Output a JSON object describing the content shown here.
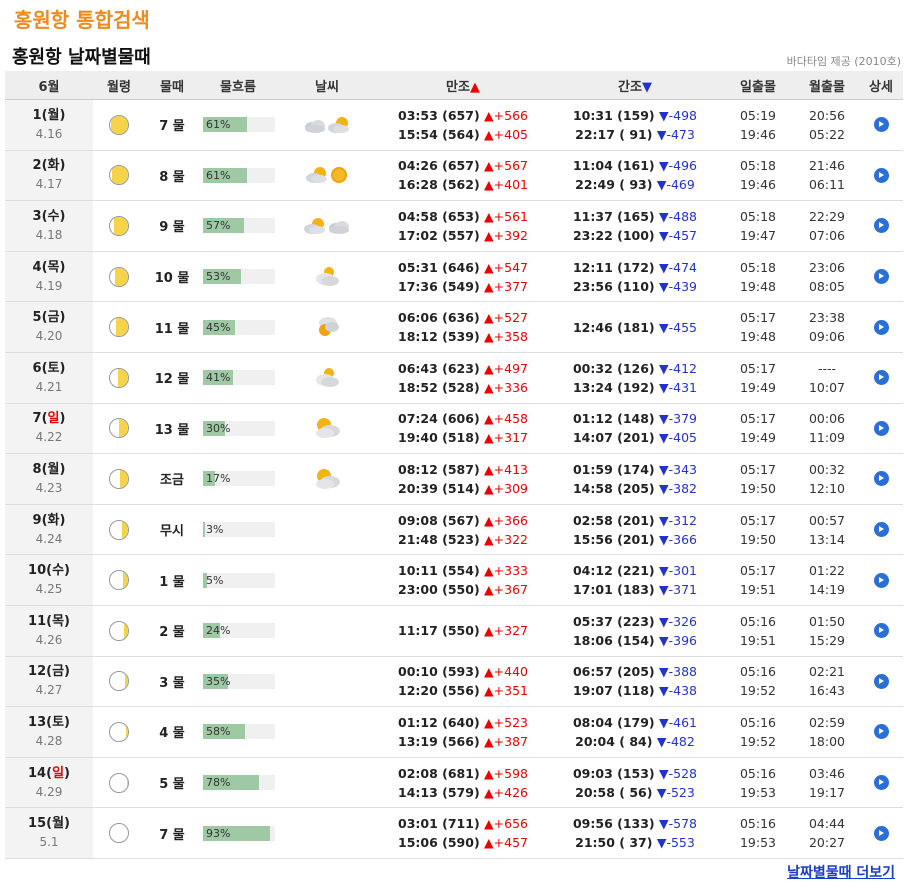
{
  "page_title": "홍원항 통합검색",
  "section_title": "홍원항 날짜별물때",
  "provider": "바다타임 제공 (2010호)",
  "headers": {
    "month": "6월",
    "moon": "월령",
    "tide": "물때",
    "flow": "물흐름",
    "weather": "날씨",
    "high": "만조",
    "high_arrow": "▲",
    "low": "간조",
    "low_arrow": "▼",
    "sun": "일출몰",
    "moonrise": "월출몰",
    "detail": "상세"
  },
  "more_link": "날짜별물때 더보기",
  "rows": [
    {
      "day": "1(월)",
      "greg": "4.16",
      "phase": 0.93,
      "tide": "7 물",
      "flow": 61,
      "flow_label": "61%",
      "weather": [
        "cloud",
        "partly"
      ],
      "high": [
        {
          "t": "03:53 (657)",
          "d": "▲+566"
        },
        {
          "t": "15:54 (564)",
          "d": "▲+405"
        }
      ],
      "low": [
        {
          "t": "10:31 (159)",
          "d": "▼-498"
        },
        {
          "t": "22:17 ( 91)",
          "d": "▼-473"
        }
      ],
      "sun": [
        "05:19",
        "19:46"
      ],
      "moon": [
        "20:56",
        "05:22"
      ]
    },
    {
      "day": "2(화)",
      "greg": "4.17",
      "phase": 0.88,
      "tide": "8 물",
      "flow": 61,
      "flow_label": "61%",
      "weather": [
        "partly",
        "sun"
      ],
      "high": [
        {
          "t": "04:26 (657)",
          "d": "▲+567"
        },
        {
          "t": "16:28 (562)",
          "d": "▲+401"
        }
      ],
      "low": [
        {
          "t": "11:04 (161)",
          "d": "▼-496"
        },
        {
          "t": "22:49 ( 93)",
          "d": "▼-469"
        }
      ],
      "sun": [
        "05:18",
        "19:46"
      ],
      "moon": [
        "21:46",
        "06:11"
      ]
    },
    {
      "day": "3(수)",
      "greg": "4.18",
      "phase": 0.8,
      "tide": "9 물",
      "flow": 57,
      "flow_label": "57%",
      "weather": [
        "partly",
        "cloud"
      ],
      "high": [
        {
          "t": "04:58 (653)",
          "d": "▲+561"
        },
        {
          "t": "17:02 (557)",
          "d": "▲+392"
        }
      ],
      "low": [
        {
          "t": "11:37 (165)",
          "d": "▼-488"
        },
        {
          "t": "23:22 (100)",
          "d": "▼-457"
        }
      ],
      "sun": [
        "05:18",
        "19:47"
      ],
      "moon": [
        "22:29",
        "07:06"
      ]
    },
    {
      "day": "4(목)",
      "greg": "4.19",
      "phase": 0.72,
      "tide": "10 물",
      "flow": 53,
      "flow_label": "53%",
      "weather": [
        "cloudsun"
      ],
      "high": [
        {
          "t": "05:31 (646)",
          "d": "▲+547"
        },
        {
          "t": "17:36 (549)",
          "d": "▲+377"
        }
      ],
      "low": [
        {
          "t": "12:11 (172)",
          "d": "▼-474"
        },
        {
          "t": "23:56 (110)",
          "d": "▼-439"
        }
      ],
      "sun": [
        "05:18",
        "19:48"
      ],
      "moon": [
        "23:06",
        "08:05"
      ]
    },
    {
      "day": "5(금)",
      "greg": "4.20",
      "phase": 0.64,
      "tide": "11 물",
      "flow": 45,
      "flow_label": "45%",
      "weather": [
        "sunbelow"
      ],
      "high": [
        {
          "t": "06:06 (636)",
          "d": "▲+527"
        },
        {
          "t": "18:12 (539)",
          "d": "▲+358"
        }
      ],
      "low": [
        {
          "t": "12:46 (181)",
          "d": "▼-455"
        }
      ],
      "sun": [
        "05:17",
        "19:48"
      ],
      "moon": [
        "23:38",
        "09:06"
      ]
    },
    {
      "day": "6(토)",
      "greg": "4.21",
      "phase": 0.56,
      "tide": "12 물",
      "flow": 41,
      "flow_label": "41%",
      "weather": [
        "cloudsun"
      ],
      "high": [
        {
          "t": "06:43 (623)",
          "d": "▲+497"
        },
        {
          "t": "18:52 (528)",
          "d": "▲+336"
        }
      ],
      "low": [
        {
          "t": "00:32 (126)",
          "d": "▼-412"
        },
        {
          "t": "13:24 (192)",
          "d": "▼-431"
        }
      ],
      "sun": [
        "05:17",
        "19:49"
      ],
      "moon": [
        "----",
        "10:07"
      ]
    },
    {
      "day_prefix": "7(",
      "day_sun": "일",
      "day_suffix": ")",
      "greg": "4.22",
      "phase": 0.5,
      "tide": "13 물",
      "flow": 30,
      "flow_label": "30%",
      "weather": [
        "partlybig"
      ],
      "high": [
        {
          "t": "07:24 (606)",
          "d": "▲+458"
        },
        {
          "t": "19:40 (518)",
          "d": "▲+317"
        }
      ],
      "low": [
        {
          "t": "01:12 (148)",
          "d": "▼-379"
        },
        {
          "t": "14:07 (201)",
          "d": "▼-405"
        }
      ],
      "sun": [
        "05:17",
        "19:49"
      ],
      "moon": [
        "00:06",
        "11:09"
      ]
    },
    {
      "day": "8(월)",
      "greg": "4.23",
      "phase": 0.42,
      "tide": "조금",
      "flow": 17,
      "flow_label": "17%",
      "weather": [
        "partlybig"
      ],
      "high": [
        {
          "t": "08:12 (587)",
          "d": "▲+413"
        },
        {
          "t": "20:39 (514)",
          "d": "▲+309"
        }
      ],
      "low": [
        {
          "t": "01:59 (174)",
          "d": "▼-343"
        },
        {
          "t": "14:58 (205)",
          "d": "▼-382"
        }
      ],
      "sun": [
        "05:17",
        "19:50"
      ],
      "moon": [
        "00:32",
        "12:10"
      ]
    },
    {
      "day": "9(화)",
      "greg": "4.24",
      "phase": 0.35,
      "tide": "무시",
      "flow": 3,
      "flow_label": "3%",
      "weather": [],
      "high": [
        {
          "t": "09:08 (567)",
          "d": "▲+366"
        },
        {
          "t": "21:48 (523)",
          "d": "▲+322"
        }
      ],
      "low": [
        {
          "t": "02:58 (201)",
          "d": "▼-312"
        },
        {
          "t": "15:56 (201)",
          "d": "▼-366"
        }
      ],
      "sun": [
        "05:17",
        "19:50"
      ],
      "moon": [
        "00:57",
        "13:14"
      ]
    },
    {
      "day": "10(수)",
      "greg": "4.25",
      "phase": 0.3,
      "tide": "1 물",
      "flow": 5,
      "flow_label": "5%",
      "weather": [],
      "high": [
        {
          "t": "10:11 (554)",
          "d": "▲+333"
        },
        {
          "t": "23:00 (550)",
          "d": "▲+367"
        }
      ],
      "low": [
        {
          "t": "04:12 (221)",
          "d": "▼-301"
        },
        {
          "t": "17:01 (183)",
          "d": "▼-371"
        }
      ],
      "sun": [
        "05:17",
        "19:51"
      ],
      "moon": [
        "01:22",
        "14:19"
      ]
    },
    {
      "day": "11(목)",
      "greg": "4.26",
      "phase": 0.24,
      "tide": "2 물",
      "flow": 24,
      "flow_label": "24%",
      "weather": [],
      "high": [
        {
          "t": "11:17 (550)",
          "d": "▲+327"
        }
      ],
      "low": [
        {
          "t": "05:37 (223)",
          "d": "▼-326"
        },
        {
          "t": "18:06 (154)",
          "d": "▼-396"
        }
      ],
      "sun": [
        "05:16",
        "19:51"
      ],
      "moon": [
        "01:50",
        "15:29"
      ]
    },
    {
      "day": "12(금)",
      "greg": "4.27",
      "phase": 0.18,
      "tide": "3 물",
      "flow": 35,
      "flow_label": "35%",
      "weather": [],
      "high": [
        {
          "t": "00:10 (593)",
          "d": "▲+440"
        },
        {
          "t": "12:20 (556)",
          "d": "▲+351"
        }
      ],
      "low": [
        {
          "t": "06:57 (205)",
          "d": "▼-388"
        },
        {
          "t": "19:07 (118)",
          "d": "▼-438"
        }
      ],
      "sun": [
        "05:16",
        "19:52"
      ],
      "moon": [
        "02:21",
        "16:43"
      ]
    },
    {
      "day": "13(토)",
      "greg": "4.28",
      "phase": 0.12,
      "tide": "4 물",
      "flow": 58,
      "flow_label": "58%",
      "weather": [],
      "high": [
        {
          "t": "01:12 (640)",
          "d": "▲+523"
        },
        {
          "t": "13:19 (566)",
          "d": "▲+387"
        }
      ],
      "low": [
        {
          "t": "08:04 (179)",
          "d": "▼-461"
        },
        {
          "t": "20:04 ( 84)",
          "d": "▼-482"
        }
      ],
      "sun": [
        "05:16",
        "19:52"
      ],
      "moon": [
        "02:59",
        "18:00"
      ]
    },
    {
      "day_prefix": "14(",
      "day_sun": "일",
      "day_suffix": ")",
      "greg": "4.29",
      "phase": 0.06,
      "tide": "5 물",
      "flow": 78,
      "flow_label": "78%",
      "weather": [],
      "high": [
        {
          "t": "02:08 (681)",
          "d": "▲+598"
        },
        {
          "t": "14:13 (579)",
          "d": "▲+426"
        }
      ],
      "low": [
        {
          "t": "09:03 (153)",
          "d": "▼-528"
        },
        {
          "t": "20:58 ( 56)",
          "d": "▼-523"
        }
      ],
      "sun": [
        "05:16",
        "19:53"
      ],
      "moon": [
        "03:46",
        "19:17"
      ]
    },
    {
      "day": "15(월)",
      "greg": "5.1",
      "phase": 0.02,
      "tide": "7 물",
      "flow": 93,
      "flow_label": "93%",
      "weather": [],
      "high": [
        {
          "t": "03:01 (711)",
          "d": "▲+656"
        },
        {
          "t": "15:06 (590)",
          "d": "▲+457"
        }
      ],
      "low": [
        {
          "t": "09:56 (133)",
          "d": "▼-578"
        },
        {
          "t": "21:50 ( 37)",
          "d": "▼-553"
        }
      ],
      "sun": [
        "05:16",
        "19:53"
      ],
      "moon": [
        "04:44",
        "20:27"
      ]
    }
  ]
}
